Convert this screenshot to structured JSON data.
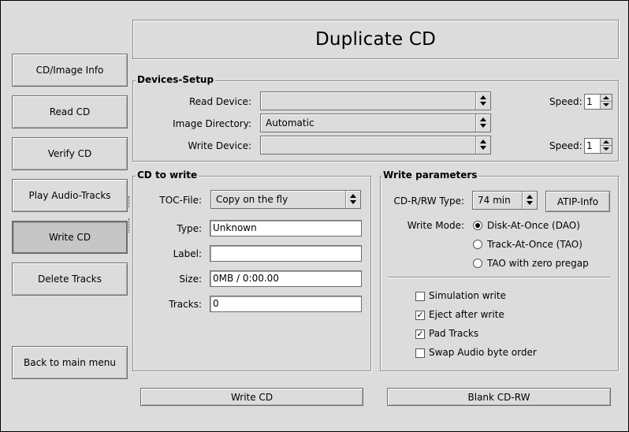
{
  "title": "Duplicate CD",
  "sidebar": {
    "items": [
      {
        "label": "CD/Image Info"
      },
      {
        "label": "Read CD"
      },
      {
        "label": "Verify CD"
      },
      {
        "label": "Play Audio-Tracks"
      },
      {
        "label": "Write CD",
        "active": true
      },
      {
        "label": "Delete Tracks"
      }
    ],
    "back_label": "Back to main menu"
  },
  "devices": {
    "title": "Devices-Setup",
    "read_device_label": "Read Device:",
    "read_device_value": "",
    "image_dir_label": "Image Directory:",
    "image_dir_value": "Automatic",
    "write_device_label": "Write Device:",
    "write_device_value": "",
    "speed_label": "Speed:",
    "read_speed": "1",
    "write_speed": "1"
  },
  "cd_to_write": {
    "title": "CD to write",
    "toc_label": "TOC-File:",
    "toc_value": "Copy on the fly",
    "type_label": "Type:",
    "type_value": "Unknown",
    "label_label": "Label:",
    "label_value": "",
    "size_label": "Size:",
    "size_value": "0MB / 0:00.00",
    "tracks_label": "Tracks:",
    "tracks_value": "0"
  },
  "write_params": {
    "title": "Write parameters",
    "cdrw_type_label": "CD-R/RW Type:",
    "cdrw_type_value": "74 min",
    "atip_label": "ATIP-Info",
    "write_mode_label": "Write Mode:",
    "modes": [
      {
        "label": "Disk-At-Once (DAO)",
        "selected": true
      },
      {
        "label": "Track-At-Once (TAO)",
        "selected": false
      },
      {
        "label": "TAO with zero pregap",
        "selected": false
      }
    ],
    "options": [
      {
        "label": "Simulation write",
        "checked": false
      },
      {
        "label": "Eject after write",
        "checked": true
      },
      {
        "label": "Pad Tracks",
        "checked": true
      },
      {
        "label": "Swap Audio byte order",
        "checked": false
      }
    ]
  },
  "actions": {
    "write_label": "Write CD",
    "blank_label": "Blank CD-RW"
  }
}
